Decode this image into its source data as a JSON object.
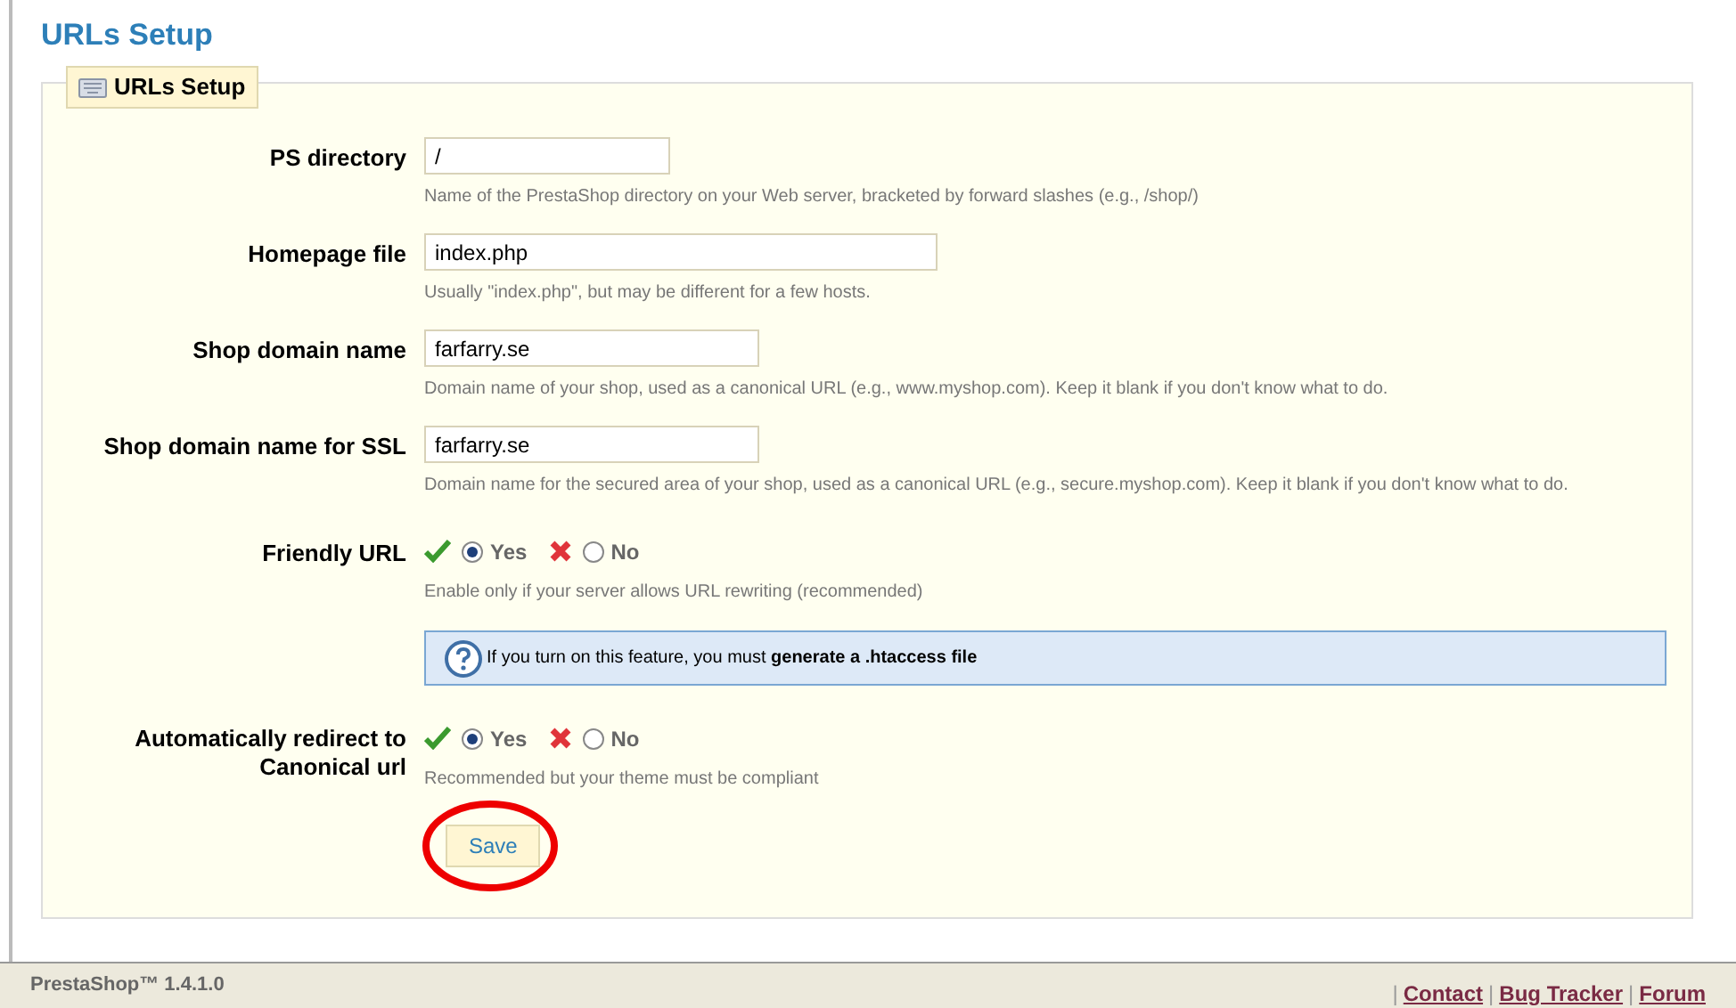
{
  "page_title": "URLs Setup",
  "fieldset": {
    "legend": "URLs Setup"
  },
  "fields": [
    {
      "kind": "text",
      "label": "PS directory",
      "value": "/",
      "hint": "Name of the PrestaShop directory on your Web server, bracketed by forward slashes (e.g., /shop/)"
    },
    {
      "kind": "text",
      "label": "Homepage file",
      "value": "index.php",
      "hint": "Usually \"index.php\", but may be different for a few hosts."
    },
    {
      "kind": "text",
      "label": "Shop domain name",
      "value": "farfarry.se",
      "hint": "Domain name of your shop, used as a canonical URL (e.g., www.myshop.com). Keep it blank if you don't know what to do."
    },
    {
      "kind": "text",
      "label": "Shop domain name for SSL",
      "value": "farfarry.se",
      "hint": "Domain name for the secured area of your shop, used as a canonical URL (e.g., secure.myshop.com). Keep it blank if you don't know what to do."
    },
    {
      "kind": "radio",
      "label": "Friendly URL",
      "options": [
        {
          "label": "Yes",
          "selected": true
        },
        {
          "label": "No",
          "selected": false
        }
      ],
      "hint": "Enable only if your server allows URL rewriting (recommended)",
      "info": "If you turn on this feature, you must **generate a .htaccess file**"
    },
    {
      "kind": "radio",
      "label": "Automatically redirect to Canonical url",
      "options": [
        {
          "label": "Yes",
          "selected": true
        },
        {
          "label": "No",
          "selected": false
        }
      ],
      "hint": "Recommended but your theme must be compliant"
    }
  ],
  "save_button": "Save",
  "footer": {
    "version": "PrestaShop™ 1.4.1.0",
    "separator": "|",
    "links": [
      "Contact",
      "Bug Tracker",
      "Forum"
    ]
  }
}
